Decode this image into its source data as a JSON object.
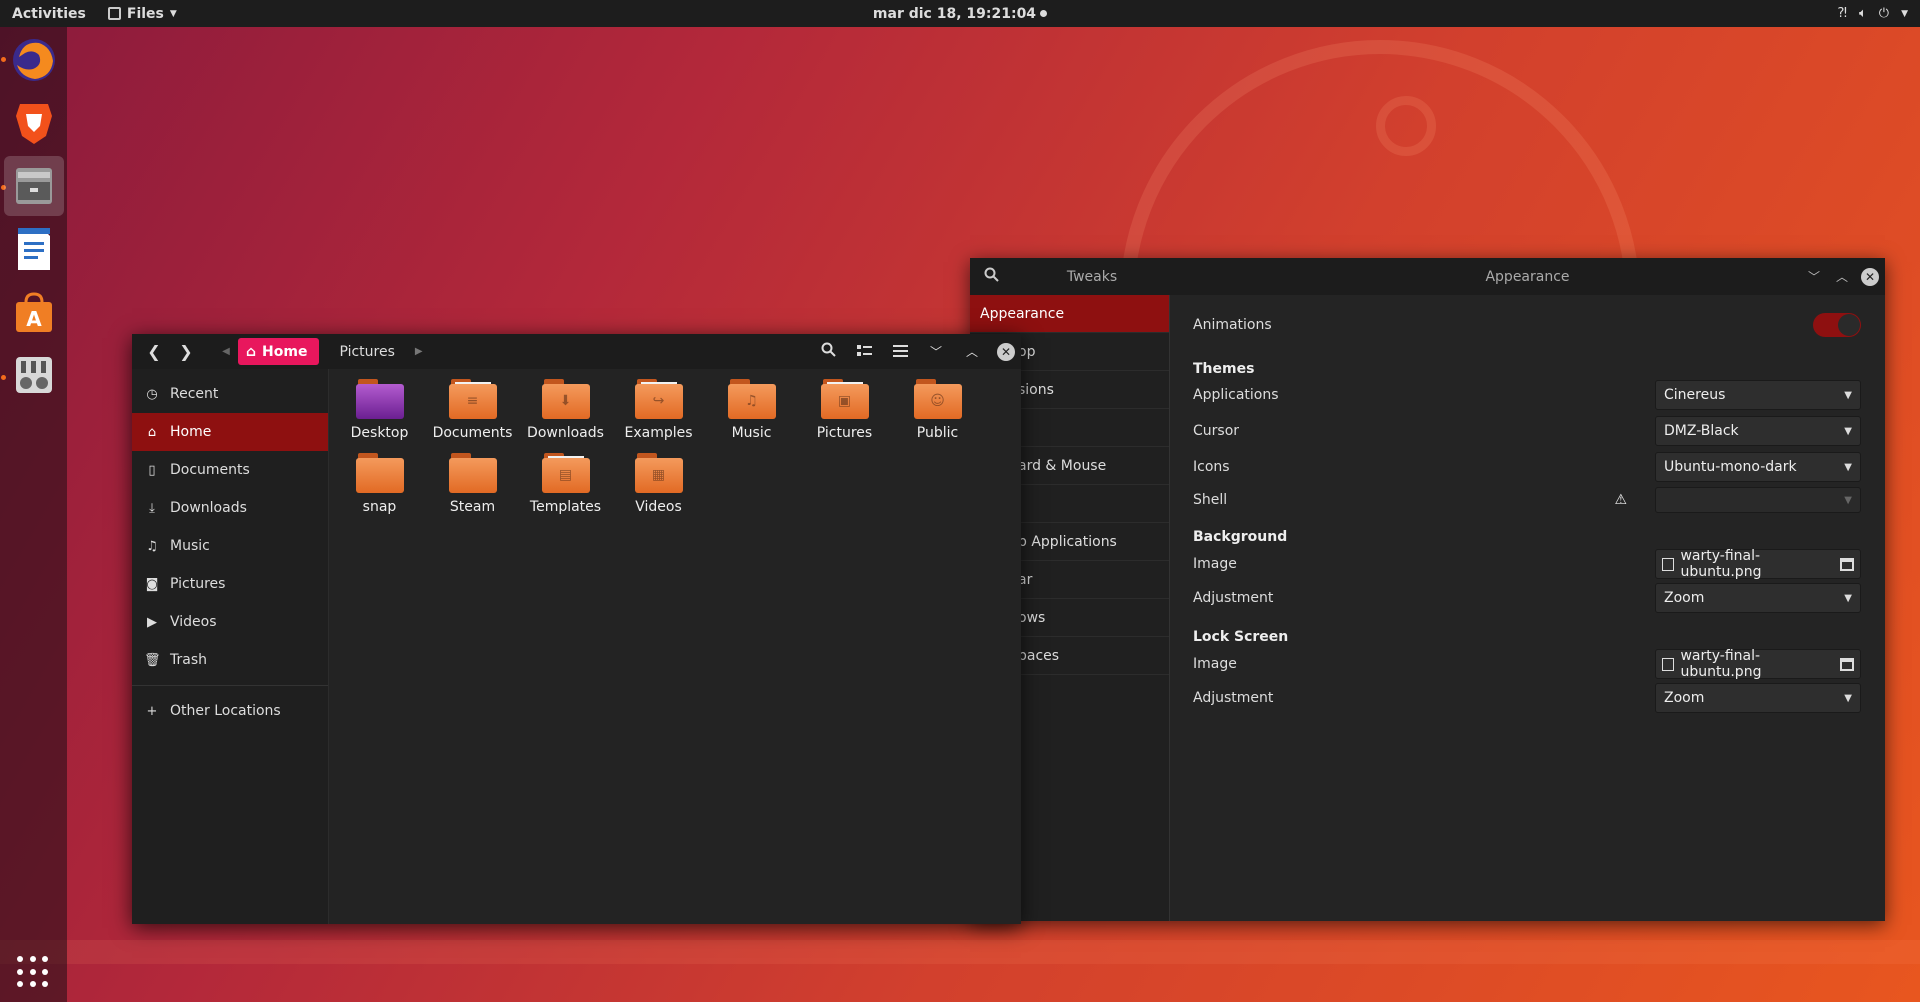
{
  "topbar": {
    "activities": "Activities",
    "app_menu": "Files",
    "clock": "mar dic 18, 19:21:04"
  },
  "dock": {
    "items": [
      {
        "name": "firefox",
        "running": true
      },
      {
        "name": "brave",
        "running": false
      },
      {
        "name": "files",
        "running": true,
        "active": true
      },
      {
        "name": "libreoffice-writer",
        "running": false
      },
      {
        "name": "ubuntu-software",
        "running": false
      },
      {
        "name": "gnome-tweaks",
        "running": true
      }
    ]
  },
  "tweaks": {
    "header_title": "Tweaks",
    "page_title": "Appearance",
    "sidebar": [
      "Appearance",
      "op",
      "sions",
      "",
      "ard & Mouse",
      "",
      "p Applications",
      "ar",
      "ows",
      "paces"
    ],
    "animations_label": "Animations",
    "animations_on": true,
    "themes_heading": "Themes",
    "applications_label": "Applications",
    "applications_value": "Cinereus",
    "cursor_label": "Cursor",
    "cursor_value": "DMZ-Black",
    "icons_label": "Icons",
    "icons_value": "Ubuntu-mono-dark",
    "shell_label": "Shell",
    "shell_value": "",
    "background_heading": "Background",
    "bg_image_label": "Image",
    "bg_image_value": "warty-final-ubuntu.png",
    "bg_adjust_label": "Adjustment",
    "bg_adjust_value": "Zoom",
    "lock_heading": "Lock Screen",
    "lock_image_label": "Image",
    "lock_image_value": "warty-final-ubuntu.png",
    "lock_adjust_label": "Adjustment",
    "lock_adjust_value": "Zoom"
  },
  "files": {
    "breadcrumb_home": "Home",
    "breadcrumb_next": "Pictures",
    "sidebar": {
      "recent": "Recent",
      "home": "Home",
      "documents": "Documents",
      "downloads": "Downloads",
      "music": "Music",
      "pictures": "Pictures",
      "videos": "Videos",
      "trash": "Trash",
      "other": "Other Locations"
    },
    "folders": [
      "Desktop",
      "Documents",
      "Downloads",
      "Examples",
      "Music",
      "Pictures",
      "Public",
      "snap",
      "Steam",
      "Templates",
      "Videos"
    ]
  },
  "colors": {
    "accent_red": "#8e1010",
    "home_pink": "#e8175d",
    "folder_orange": "#e26a24"
  }
}
